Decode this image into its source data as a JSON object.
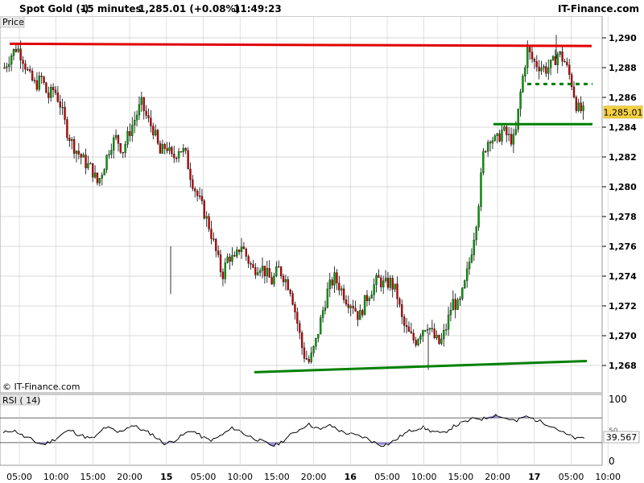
{
  "header": {
    "instrument": "Spot Gold (-)",
    "timeframe": "15 minutes",
    "last_change": "1,285.01 (+0.08%)",
    "time": "11:49:23",
    "brand": "IT-Finance.com"
  },
  "price_panel": {
    "label": "Price",
    "watermark": "© IT-Finance.com",
    "last_price_label": "1,285.01",
    "y_ticks": [
      "1,268",
      "1,270",
      "1,272",
      "1,274",
      "1,276",
      "1,278",
      "1,280",
      "1,282",
      "1,284",
      "1,286",
      "1,288",
      "1,290"
    ]
  },
  "rsi_panel": {
    "label": "RSI ( 14)",
    "last_value_label": "39.567",
    "y_ticks": [
      "100",
      "50",
      "0"
    ],
    "overbought": 70,
    "oversold": 30
  },
  "x_axis": {
    "labels": [
      "05:00",
      "10:00",
      "15:00",
      "20:00",
      "15",
      "05:00",
      "10:00",
      "15:00",
      "20:00",
      "16",
      "05:00",
      "10:00",
      "15:00",
      "20:00",
      "17",
      "05:00",
      "10:00"
    ],
    "bold_labels": [
      "15",
      "16",
      "17"
    ]
  },
  "colors": {
    "up_candle": "#00a000",
    "down_candle": "#cc0000",
    "wick": "#000000",
    "resistance_line": "#e00000",
    "support_line": "#008000",
    "last_price_bg": "#f5d142",
    "rsi_line": "#000000",
    "rsi_fill": "#9a8ad8",
    "grid": "#cccccc"
  },
  "chart_data": {
    "type": "candlestick",
    "title": "Spot Gold (-)",
    "timeframe": "15 minutes",
    "y_range": [
      1266.5,
      1291.0
    ],
    "x_ticks": [
      "05:00",
      "10:00",
      "15:00",
      "20:00",
      "15",
      "05:00",
      "10:00",
      "15:00",
      "20:00",
      "16",
      "05:00",
      "10:00",
      "15:00",
      "20:00",
      "17",
      "05:00",
      "10:00"
    ],
    "close_path": [
      1288.0,
      1288.8,
      1289.4,
      1288.6,
      1287.4,
      1286.8,
      1287.3,
      1286.0,
      1286.6,
      1285.5,
      1283.8,
      1282.8,
      1282.2,
      1281.6,
      1281.2,
      1280.2,
      1281.4,
      1282.8,
      1283.3,
      1282.4,
      1283.6,
      1284.6,
      1285.6,
      1284.5,
      1283.8,
      1282.2,
      1282.8,
      1281.8,
      1282.6,
      1282.3,
      1280.6,
      1279.4,
      1278.4,
      1277.2,
      1275.6,
      1274.0,
      1275.4,
      1275.0,
      1276.2,
      1275.2,
      1274.4,
      1274.8,
      1274.2,
      1273.6,
      1274.5,
      1273.9,
      1273.1,
      1271.0,
      1268.8,
      1268.2,
      1269.5,
      1271.4,
      1273.1,
      1273.9,
      1273.2,
      1272.4,
      1272.1,
      1271.2,
      1272.4,
      1273.1,
      1273.8,
      1273.4,
      1273.6,
      1272.9,
      1270.8,
      1270.1,
      1269.6,
      1270.4,
      1270.8,
      1269.9,
      1269.4,
      1270.6,
      1272.3,
      1271.9,
      1273.5,
      1275.6,
      1278.2,
      1282.4,
      1283.4,
      1283.0,
      1283.8,
      1283.3,
      1283.1,
      1286.6,
      1289.2,
      1288.4,
      1288.1,
      1287.9,
      1288.2,
      1289.0,
      1288.4,
      1287.2,
      1285.3,
      1285.0
    ],
    "last_price": 1285.01,
    "annotations": [
      {
        "type": "resistance",
        "from": 1289.5,
        "to": 1289.4
      },
      {
        "type": "support_solid",
        "level": 1284.2
      },
      {
        "type": "support_dashed",
        "level": 1286.9
      },
      {
        "type": "trendline_low",
        "from": 1267.5,
        "to": 1268.3
      }
    ],
    "rsi": {
      "label": "RSI ( 14)",
      "last": 39.567,
      "levels": [
        30,
        70
      ],
      "y_range": [
        0,
        100
      ],
      "path": [
        45,
        50,
        48,
        40,
        36,
        30,
        27,
        32,
        38,
        46,
        50,
        44,
        40,
        36,
        42,
        55,
        52,
        46,
        52,
        58,
        54,
        48,
        44,
        35,
        28,
        32,
        38,
        45,
        50,
        42,
        36,
        34,
        40,
        47,
        54,
        49,
        42,
        38,
        33,
        29,
        25,
        30,
        38,
        46,
        52,
        60,
        56,
        50,
        58,
        55,
        48,
        45,
        42,
        40,
        36,
        30,
        26,
        28,
        34,
        42,
        48,
        52,
        55,
        50,
        47,
        44,
        52,
        58,
        62,
        66,
        70,
        68,
        72,
        75,
        70,
        68,
        64,
        72,
        70,
        66,
        62,
        58,
        52,
        45,
        40,
        36,
        38
      ]
    }
  }
}
